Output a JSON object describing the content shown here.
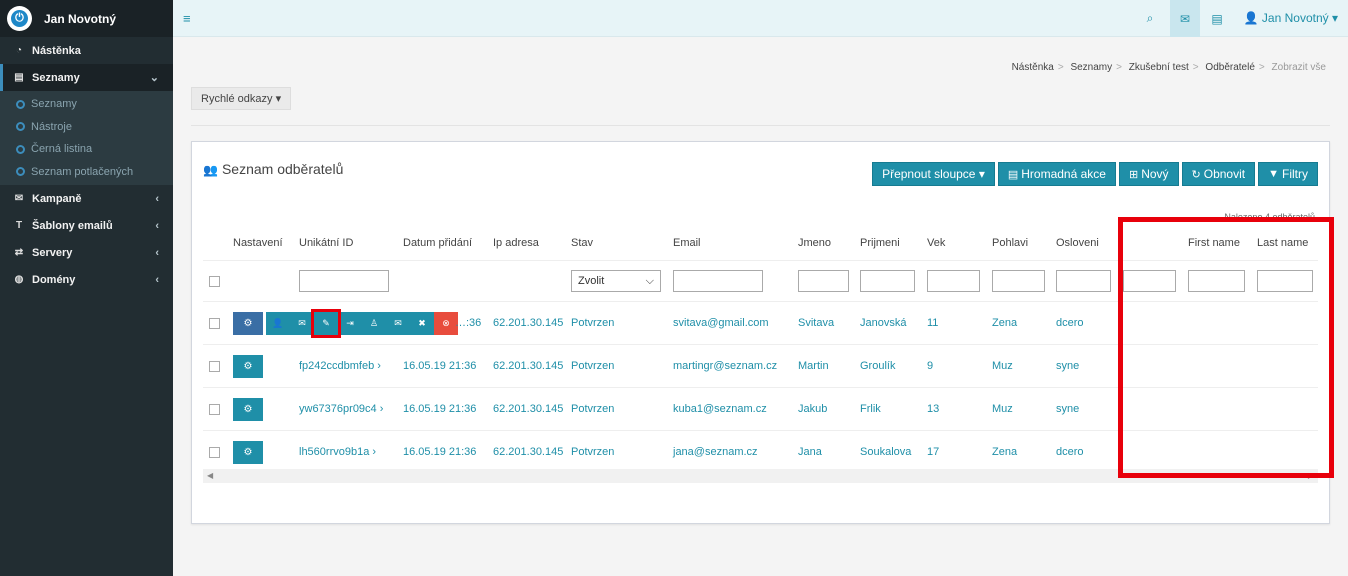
{
  "app": {
    "user_name": "Jan Novotný"
  },
  "sidebar": {
    "items": [
      {
        "label": "Nástěnka",
        "icon": "dashboard-icon"
      },
      {
        "label": "Seznamy",
        "icon": "list-icon",
        "active": true
      },
      {
        "label": "Kampaně",
        "icon": "envelope-icon"
      },
      {
        "label": "Šablony emailů",
        "icon": "text-icon"
      },
      {
        "label": "Servery",
        "icon": "exchange-icon"
      },
      {
        "label": "Domény",
        "icon": "globe-icon"
      }
    ],
    "subitems": [
      "Seznamy",
      "Nástroje",
      "Černá listina",
      "Seznam potlačených"
    ]
  },
  "topbar": {
    "user_label": "Jan Novotný"
  },
  "breadcrumb": [
    "Nástěnka",
    "Seznamy",
    "Zkušební test",
    "Odběratelé",
    "Zobrazit vše"
  ],
  "quick_links": "Rychlé odkazy",
  "panel": {
    "title": "Seznam odběratelů",
    "buttons": {
      "toggle_columns": "Přepnout sloupce",
      "bulk_action": "Hromadná akce",
      "new": "Nový",
      "refresh": "Obnovit",
      "filters": "Filtry"
    },
    "found": "Nalezeno 4 odběratelů"
  },
  "table": {
    "columns": [
      "Nastavení",
      "Unikátní ID",
      "Datum přidání",
      "Ip adresa",
      "Stav",
      "Email",
      "Jmeno",
      "Prijmeni",
      "Vek",
      "Pohlavi",
      "Osloveni",
      "",
      "First name",
      "Last name"
    ],
    "filter_select": "Zvolit",
    "rows": [
      {
        "uid": "",
        "date": "…:36",
        "ip": "62.201.30.145",
        "state": "Potvrzen",
        "email": "svitava@gmail.com",
        "first": "Svitava",
        "last": "Janovská",
        "age": "11",
        "gender": "Zena",
        "salutation": "dcero"
      },
      {
        "uid": "fp242ccdbmfeb ›",
        "date": "16.05.19 21:36",
        "ip": "62.201.30.145",
        "state": "Potvrzen",
        "email": "martingr@seznam.cz",
        "first": "Martin",
        "last": "Groulík",
        "age": "9",
        "gender": "Muz",
        "salutation": "syne"
      },
      {
        "uid": "yw67376pr09c4 ›",
        "date": "16.05.19 21:36",
        "ip": "62.201.30.145",
        "state": "Potvrzen",
        "email": "kuba1@seznam.cz",
        "first": "Jakub",
        "last": "Frlik",
        "age": "13",
        "gender": "Muz",
        "salutation": "syne"
      },
      {
        "uid": "lh560rrvo9b1a ›",
        "date": "16.05.19 21:36",
        "ip": "62.201.30.145",
        "state": "Potvrzen",
        "email": "jana@seznam.cz",
        "first": "Jana",
        "last": "Soukalova",
        "age": "17",
        "gender": "Zena",
        "salutation": "dcero"
      }
    ]
  },
  "colors": {
    "accent": "#1f8fa8",
    "sidebar": "#222d32",
    "highlight": "#e8000b",
    "danger": "#e84c3d"
  }
}
